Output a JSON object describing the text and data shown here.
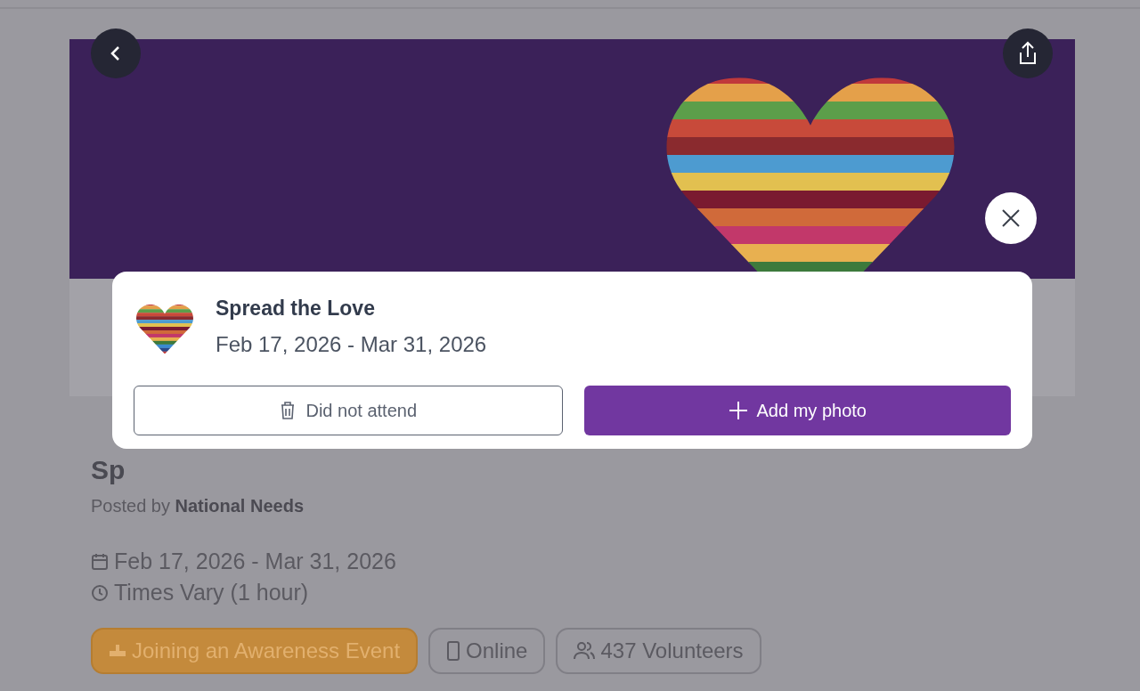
{
  "page": {
    "heading": "Sp",
    "posted_by_label": "Posted by",
    "posted_by": "National Needs",
    "dates": "Feb 17, 2026 - Mar 31, 2026",
    "times": "Times Vary (1 hour)",
    "tags": [
      {
        "kind": "category",
        "label": "Joining an Awareness Event"
      },
      {
        "kind": "online",
        "label": "Online"
      },
      {
        "kind": "volunteers",
        "label": "437 Volunteers"
      }
    ]
  },
  "dialog": {
    "title": "Spread the Love",
    "dates": "Feb 17, 2026 - Mar 31, 2026",
    "buttons": [
      {
        "kind": "secondary",
        "label": "Did not attend"
      },
      {
        "kind": "primary",
        "label": "Add my photo"
      }
    ]
  }
}
